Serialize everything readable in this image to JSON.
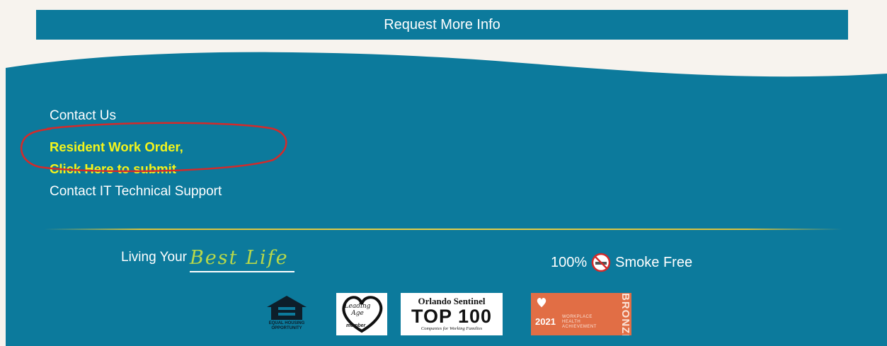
{
  "cta": {
    "label": "Request More Info"
  },
  "links": {
    "contact_us": "Contact Us",
    "work_order_line1": "Resident Work Order,",
    "work_order_line2": "Click Here to submit",
    "it_support": "Contact IT Technical Support"
  },
  "slogan": {
    "lead": "Living Your",
    "script": "Best Life"
  },
  "smoke_free": {
    "text": "100%",
    "tail": "Smoke Free",
    "icon": "no-smoking-icon"
  },
  "badges": {
    "eho_label_line1": "EQUAL HOUSING",
    "eho_label_line2": "OPPORTUNITY",
    "leadingage_name": "Leading Age",
    "leadingage_member": "member",
    "orlando_name": "Orlando Sentinel",
    "orlando_top": "TOP 100",
    "orlando_sub": "Companies for Working Families",
    "bronze_year": "2021",
    "bronze_line1": "WORKPLACE",
    "bronze_line2": "HEALTH",
    "bronze_line3": "ACHIEVEMENT",
    "bronze_metal": "BRONZE"
  },
  "colors": {
    "teal": "#0c7a9c",
    "yellow_link": "#f5f51b",
    "cream": "#f7f3ee",
    "annotation_red": "#d42a2a",
    "bronze": "#e16e45"
  }
}
